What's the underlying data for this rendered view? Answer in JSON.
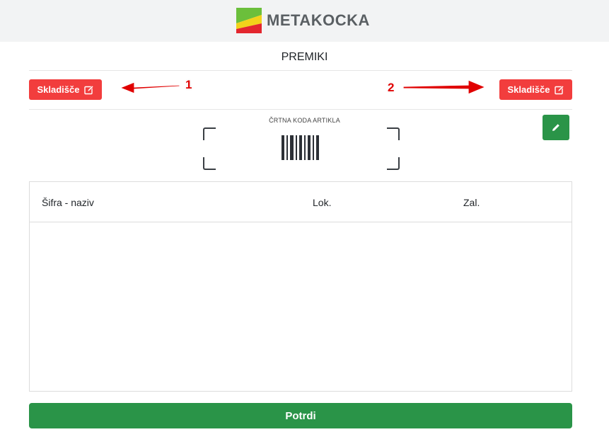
{
  "header": {
    "logo_text": "METAKOCKA"
  },
  "page": {
    "title": "PREMIKI"
  },
  "warehouse_from": {
    "label": "Skladišče",
    "icon": "edit-icon",
    "color": "#f23d3d"
  },
  "warehouse_to": {
    "label": "Skladišče",
    "icon": "edit-icon",
    "color": "#f23d3d"
  },
  "annotations": [
    {
      "number": "1"
    },
    {
      "number": "2"
    }
  ],
  "scanner": {
    "label": "ČRTNA KODA ARTIKLA",
    "icon": "barcode-icon"
  },
  "edit_button": {
    "icon": "pencil-icon",
    "color": "#2a9448"
  },
  "table": {
    "columns": [
      "Šifra - naziv",
      "Lok.",
      "Zal."
    ],
    "rows": []
  },
  "confirm_button": {
    "label": "Potrdi",
    "color": "#2a9448"
  }
}
